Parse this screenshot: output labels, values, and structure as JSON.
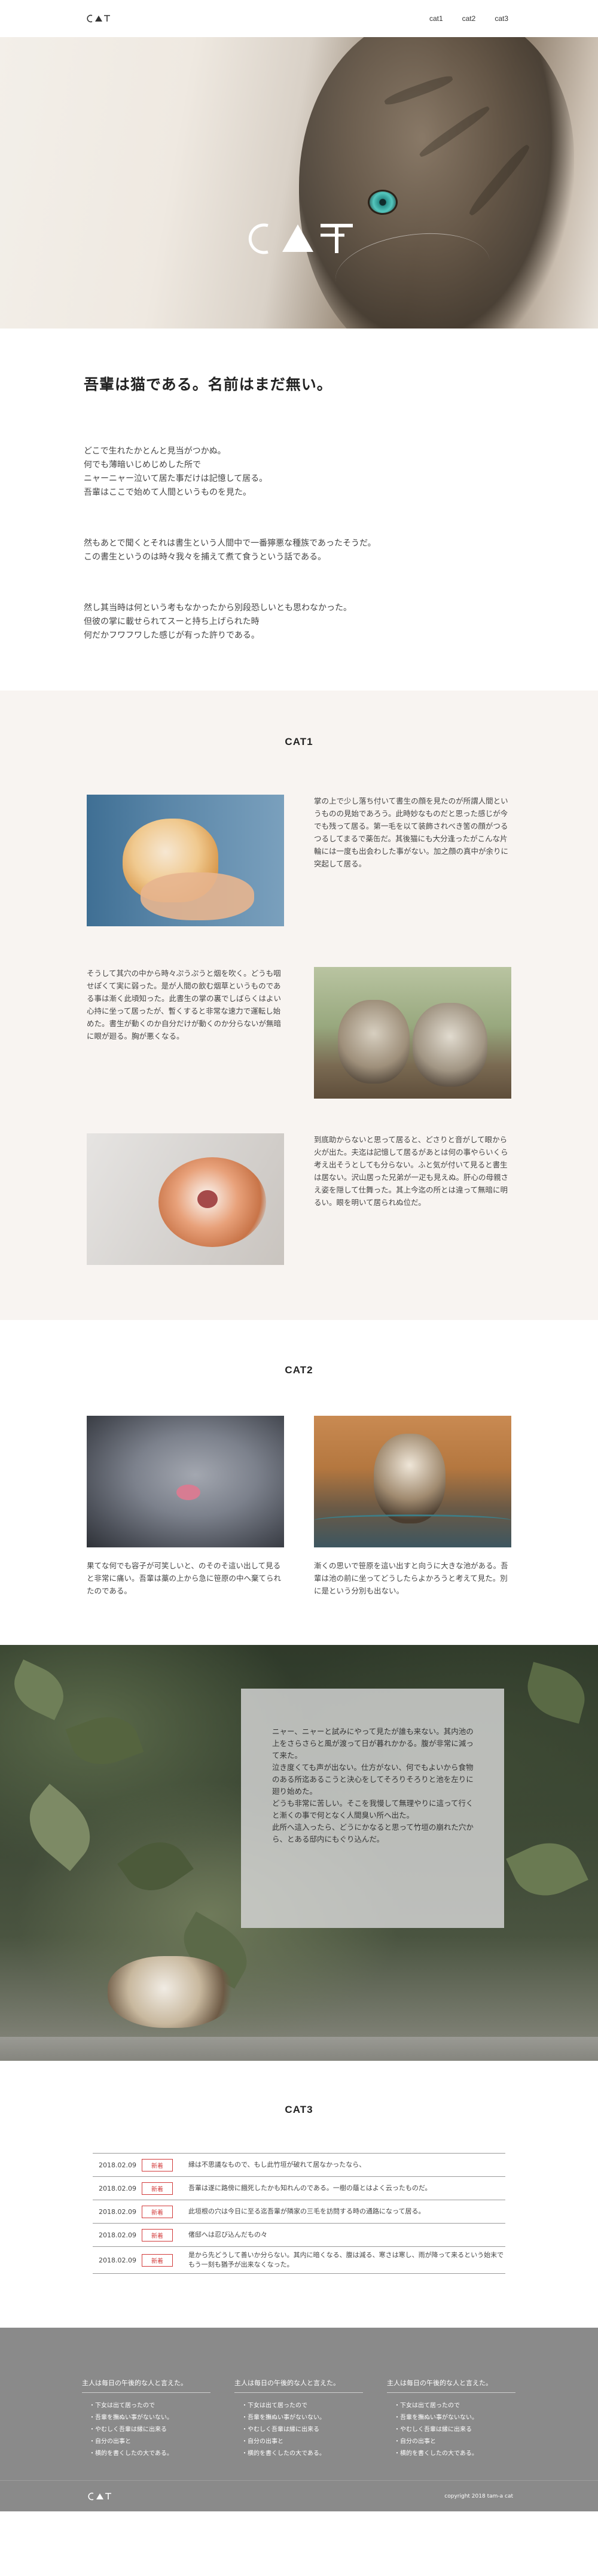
{
  "header": {
    "logo": "CAT",
    "nav": [
      "cat1",
      "cat2",
      "cat3"
    ]
  },
  "hero": {
    "logo": "CAT"
  },
  "intro": {
    "title": "吾輩は猫である。名前はまだ無い。",
    "paragraphs": [
      "どこで生れたかとんと見当がつかぬ。\n何でも薄暗いじめじめした所で\nニャーニャー泣いて居た事だけは記憶して居る。\n吾輩はここで始めて人間というものを見た。",
      "然もあとで聞くとそれは書生という人間中で一番獰悪な種族であったそうだ。\nこの書生というのは時々我々を捕えて煮て食うという話である。",
      "然し其当時は何という考もなかったから別段恐しいとも思わなかった。\n但彼の掌に載せられてスーと持ち上げられた時\n何だかフワフワした感じが有った許りである。"
    ]
  },
  "cat1": {
    "title": "CAT1",
    "items": [
      {
        "text": "掌の上で少し落ち付いて書生の顔を見たのが所謂人間というものの見始であろう。此時妙なものだと思った感じが今でも残って居る。第一毛を以て装飾されべき筈の顔がつるつるしてまるで薬缶だ。其後猫にも大分逢ったがこんな片輪には一度も出会わした事がない。加之顔の真中が余りに突起して居る。"
      },
      {
        "text": "そうして其穴の中から時々ぷうぷうと烟を吹く。どうも咽せぽくて実に弱った。是が人間の飲む烟草というものである事は漸く此頃知った。此書生の掌の裏でしばらくはよい心持に坐って居ったが、暫くすると非常な速力で運転し始めた。書生が動くのか自分だけが動くのか分らないが無暗に眼が廻る。胸が悪くなる。"
      },
      {
        "text": "到底助からないと思って居ると、どさりと音がして眼から火が出た。夫迄は記憶して居るがあとは何の事やらいくら考え出そうとしても分らない。ふと気が付いて見ると書生は居ない。沢山居った兄弟が一疋も見えぬ。肝心の母親さえ姿を隠して仕舞った。其上今迄の所とは違って無暗に明るい。眼を明いて居られぬ位だ。"
      }
    ]
  },
  "cat2": {
    "title": "CAT2",
    "items": [
      {
        "text": "果てな何でも容子が可笑しいと、のそのそ這い出して見ると非常に痛い。吾輩は藁の上から急に笹原の中へ棄てられたのである。"
      },
      {
        "text": "漸くの思いで笹原を這い出すと向うに大きな池がある。吾輩は池の前に坐ってどうしたらよかろうと考えて見た。別に是という分別も出ない。"
      }
    ]
  },
  "garden": {
    "text": "ニャー、ニャーと試みにやって見たが誰も来ない。其内池の上をさらさらと風が渡って日が暮れかかる。腹が非常に減って来た。\n泣き度くても声が出ない。仕方がない、何でもよいから食物のある所迄あるこうと決心をしてそろりそろりと池を左りに廻り始めた。\nどうも非常に苦しい。そこを我慢して無理やりに這って行くと漸くの事で何となく人間臭い所へ出た。\n此所へ這入ったら、どうにかなると思って竹垣の崩れた穴から、とある邸内にもぐり込んだ。"
  },
  "cat3": {
    "title": "CAT3",
    "news": [
      {
        "date": "2018.02.09",
        "badge": "新着",
        "text": "縁は不思議なもので、もし此竹垣が破れて居なかったなら、"
      },
      {
        "date": "2018.02.09",
        "badge": "新着",
        "text": "吾輩は遂に路傍に餓死したかも知れんのである。一樹の蔭とはよく云ったものだ。"
      },
      {
        "date": "2018.02.09",
        "badge": "新着",
        "text": "此垣根の穴は今日に至る迄吾輩が隣家の三毛を訪問する時の通路になって居る。"
      },
      {
        "date": "2018.02.09",
        "badge": "新着",
        "text": "偖邸へは忍び込んだもの々"
      },
      {
        "date": "2018.02.09",
        "badge": "新着",
        "text": "是から先どうして善いか分らない。其内に暗くなる、腹は減る、寒さは寒し、雨が降って来るという始末でもう一刻も猶予が出来なくなった。"
      }
    ]
  },
  "footer": {
    "columns": [
      {
        "heading": "主人は毎日の午後的な人と言えた。",
        "items": [
          "下女は出て居ったので",
          "吾輩を撫ぬい事がないない。",
          "やむしく吾輩は縁に出来る",
          "自分の出事と",
          "横的を書くしたの大である。"
        ]
      },
      {
        "heading": "主人は毎日の午後的な人と言えた。",
        "items": [
          "下女は出て居ったので",
          "吾輩を撫ぬい事がないない。",
          "やむしく吾輩は縁に出来る",
          "自分の出事と",
          "横的を書くしたの大である。"
        ]
      },
      {
        "heading": "主人は毎日の午後的な人と言えた。",
        "items": [
          "下女は出て居ったので",
          "吾輩を撫ぬい事がないない。",
          "やむしく吾輩は縁に出来る",
          "自分の出事と",
          "横的を書くしたの大である。"
        ]
      }
    ],
    "logo": "CAT",
    "copyright": "copyright 2018 tam-a cat"
  }
}
